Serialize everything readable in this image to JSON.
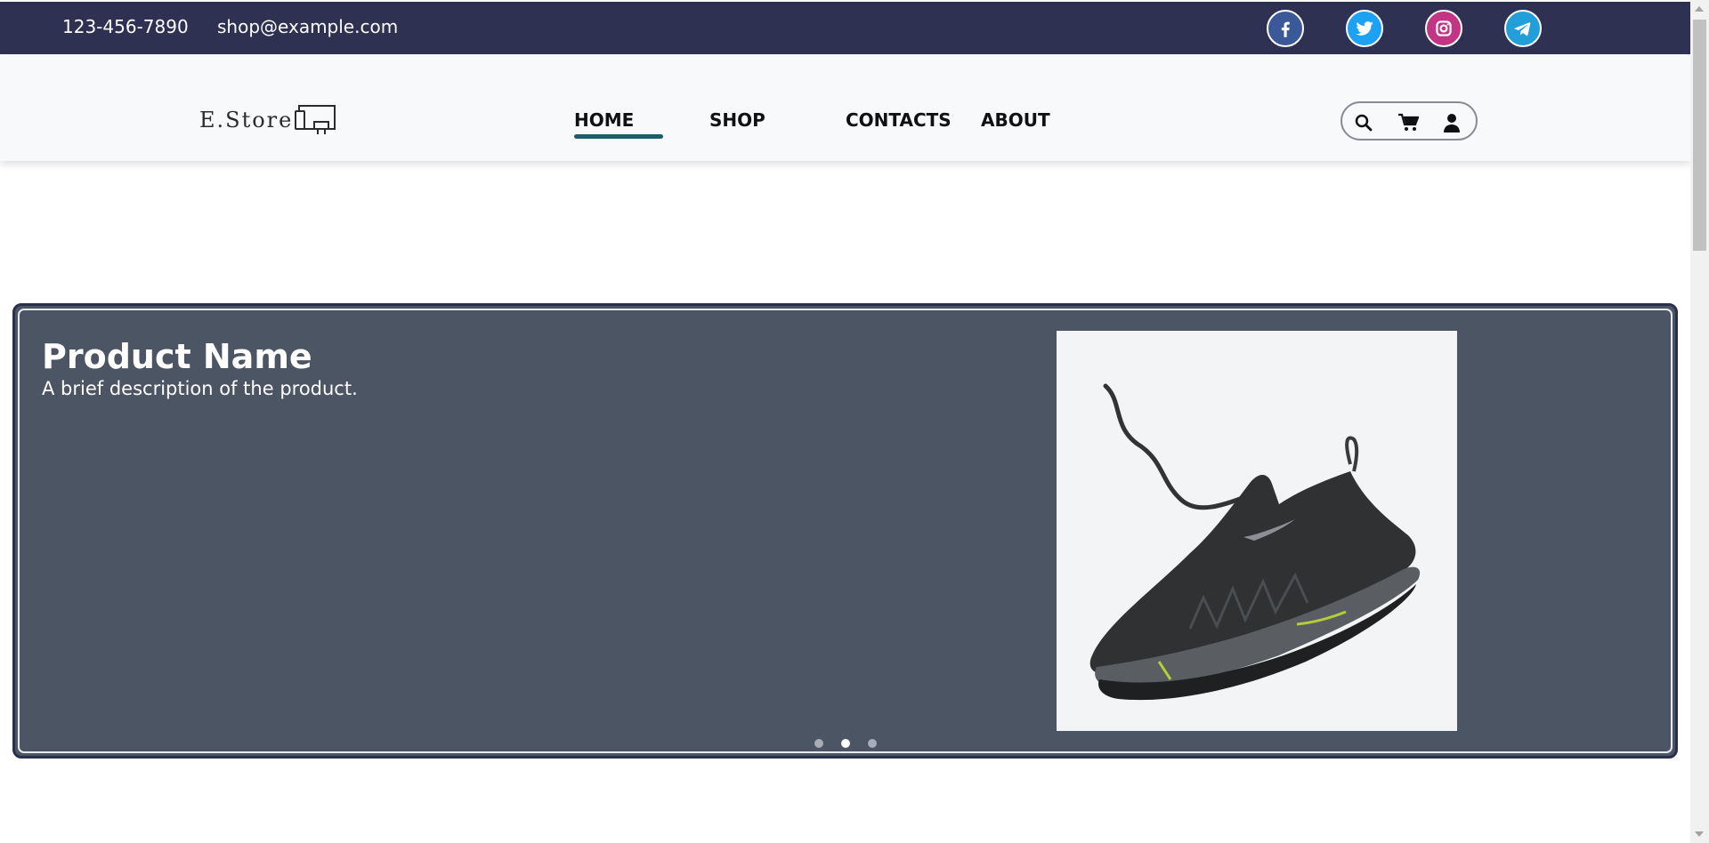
{
  "topbar": {
    "phone": "123-456-7890",
    "email": "shop@example.com",
    "social": [
      {
        "name": "facebook-icon",
        "color": "#3b5998"
      },
      {
        "name": "twitter-icon",
        "color": "#1da1f2"
      },
      {
        "name": "instagram-icon",
        "color": "#c13584"
      },
      {
        "name": "telegram-icon",
        "color": "#229ed9"
      }
    ]
  },
  "header": {
    "logo_text": "E.Store",
    "nav": {
      "home": "HOME",
      "shop": "SHOP",
      "contacts": "CONTACTS",
      "about": "ABOUT"
    },
    "active_nav": "HOME",
    "actions": [
      "search-icon",
      "cart-icon",
      "user-icon"
    ]
  },
  "carousel": {
    "product_name": "Product Name",
    "product_description": "A brief description of the product.",
    "image": "sneaker-image",
    "slides_count": 3,
    "active_slide": 2
  },
  "colors": {
    "topbar_bg": "#2e3152",
    "carousel_bg": "#4c5564",
    "nav_underline": "#1f5d6b"
  }
}
